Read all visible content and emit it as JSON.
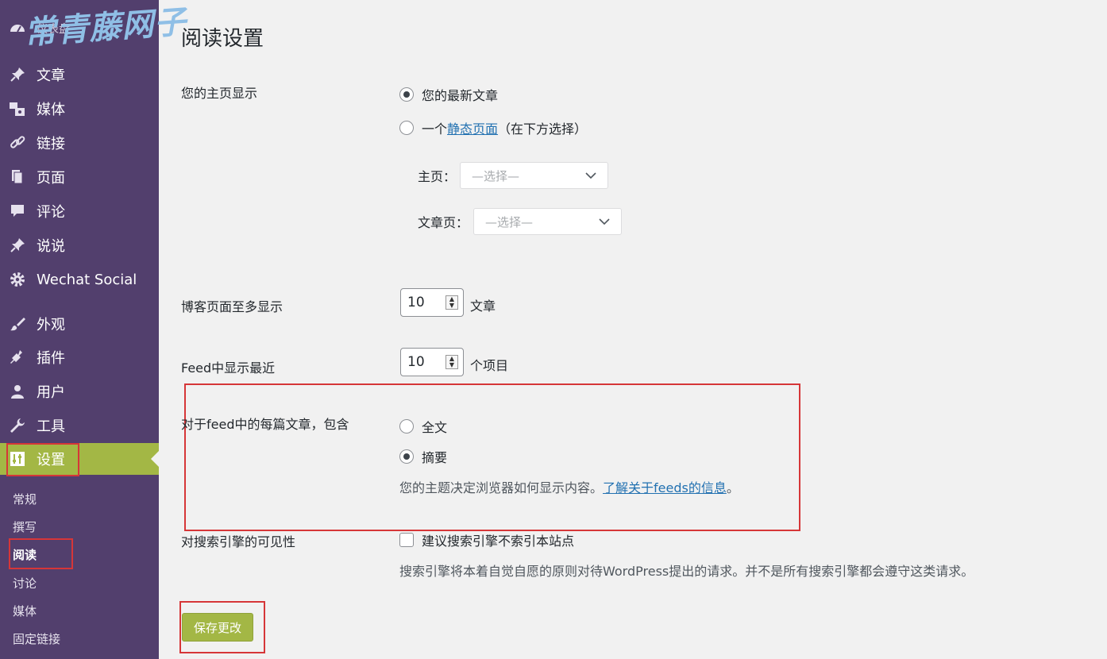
{
  "sidebar": {
    "dashboard_label": "仪表盘",
    "items": [
      {
        "label": "文章",
        "icon": "pushpin-icon"
      },
      {
        "label": "媒体",
        "icon": "media-icon"
      },
      {
        "label": "链接",
        "icon": "link-icon"
      },
      {
        "label": "页面",
        "icon": "page-icon"
      },
      {
        "label": "评论",
        "icon": "comment-icon"
      },
      {
        "label": "说说",
        "icon": "pushpin-icon"
      },
      {
        "label": "Wechat Social",
        "icon": "gear-icon"
      },
      {
        "label": "外观",
        "icon": "brush-icon"
      },
      {
        "label": "插件",
        "icon": "plugin-icon"
      },
      {
        "label": "用户",
        "icon": "user-icon"
      },
      {
        "label": "工具",
        "icon": "wrench-icon"
      },
      {
        "label": "设置",
        "icon": "settings-icon"
      }
    ],
    "submenu": [
      "常规",
      "撰写",
      "阅读",
      "讨论",
      "媒体",
      "固定链接"
    ],
    "current_item": "设置",
    "current_sub": "阅读"
  },
  "watermark": "常青藤网子",
  "page_title": "阅读设置",
  "homepage": {
    "label": "您的主页显示",
    "option_latest": "您的最新文章",
    "option_static_prefix": "一个",
    "option_static_link": "静态页面",
    "option_static_suffix": "（在下方选择）",
    "selected": "latest",
    "front_label": "主页：",
    "posts_label": "文章页：",
    "select_placeholder": "—选择—"
  },
  "posts_per_page": {
    "label": "博客页面至多显示",
    "value": "10",
    "unit": "文章"
  },
  "feed_count": {
    "label": "Feed中显示最近",
    "value": "10",
    "unit": "个项目"
  },
  "feed_content": {
    "label": "对于feed中的每篇文章，包含",
    "option_full": "全文",
    "option_summary": "摘要",
    "selected": "summary",
    "desc_prefix": "您的主题决定浏览器如何显示内容。",
    "desc_link": "了解关于feeds的信息",
    "desc_suffix": "。"
  },
  "search_visibility": {
    "label": "对搜索引擎的可见性",
    "checkbox_label": "建议搜索引擎不索引本站点",
    "checked": false,
    "desc": "搜索引擎将本着自觉自愿的原则对待WordPress提出的请求。并不是所有搜索引擎都会遵守这类请求。"
  },
  "save_button": "保存更改",
  "colors": {
    "sidebar_bg": "#523f6d",
    "accent": "#a3b745",
    "link": "#2271b1",
    "highlight_box": "#d63638"
  }
}
